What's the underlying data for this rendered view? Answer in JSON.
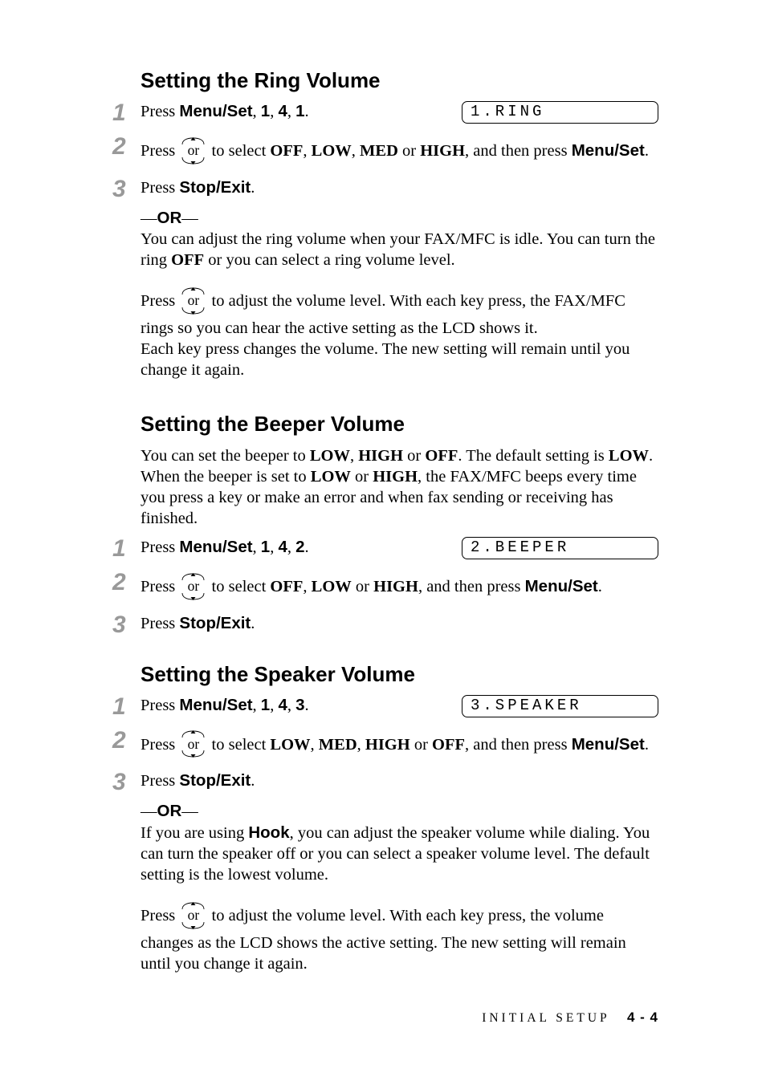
{
  "sec1": {
    "heading": "Setting the Ring Volume",
    "s1": {
      "press": "Press ",
      "key": "Menu/Set",
      "seq_a": ", ",
      "k1": "1",
      "seq_b": ", ",
      "k2": "4",
      "seq_c": ", ",
      "k3": "1",
      "end": ".",
      "lcd": "1.RING"
    },
    "s2": {
      "press": "Press ",
      "or": "or",
      "mid": " to select ",
      "o1": "OFF",
      "c1": ", ",
      "o2": "LOW",
      "c2": ", ",
      "o3": "MED",
      "c3": " or ",
      "o4": "HIGH",
      "then": ", and then press ",
      "key": "Menu/Set",
      "end": "."
    },
    "s3": {
      "press": "Press ",
      "key": "Stop/Exit",
      "end": "."
    },
    "or_pre": "—",
    "or_lbl": "OR",
    "or_suf": "—",
    "p1a": "You can adjust the ring volume when your FAX/MFC is idle. You can turn the ring ",
    "p1_off": "OFF",
    "p1b": " or you can select a ring volume level.",
    "p2a": "Press ",
    "p2_or": "or",
    "p2b": " to adjust the volume level. With each key press, the FAX/MFC rings so you can hear the active setting as the LCD shows it.",
    "p3": "Each key press changes the volume. The new setting will remain until you change it again."
  },
  "sec2": {
    "heading": "Setting the Beeper Volume",
    "p1a": "You can set the beeper to ",
    "o1": "LOW",
    "c1": ", ",
    "o2": "HIGH",
    "c2": " or ",
    "o3": "OFF",
    "p1b": ". The default setting is ",
    "o4": "LOW",
    "p1c": ". When the beeper is set to ",
    "o5": "LOW",
    "c3": " or ",
    "o6": "HIGH",
    "p1d": ", the FAX/MFC beeps every time you press a key or make an error and when fax sending or receiving has finished.",
    "s1": {
      "press": "Press ",
      "key": "Menu/Set",
      "seq_a": ", ",
      "k1": "1",
      "seq_b": ", ",
      "k2": "4",
      "seq_c": ", ",
      "k3": "2",
      "end": ".",
      "lcd": "2.BEEPER"
    },
    "s2": {
      "press": "Press ",
      "or": "or",
      "mid": " to select ",
      "o1": "OFF",
      "c1": ", ",
      "o2": "LOW",
      "c2": " or ",
      "o3": "HIGH",
      "then": ", and then press ",
      "key": "Menu/Set",
      "end": "."
    },
    "s3": {
      "press": "Press ",
      "key": "Stop/Exit",
      "end": "."
    }
  },
  "sec3": {
    "heading": "Setting the Speaker Volume",
    "s1": {
      "press": "Press ",
      "key": "Menu/Set",
      "seq_a": ", ",
      "k1": "1",
      "seq_b": ", ",
      "k2": "4",
      "seq_c": ", ",
      "k3": "3",
      "end": ".",
      "lcd": "3.SPEAKER"
    },
    "s2": {
      "press": "Press ",
      "or": "or",
      "mid": " to select ",
      "o1": "LOW",
      "c1": ", ",
      "o2": "MED",
      "c2": ", ",
      "o3": "HIGH",
      "c3": " or ",
      "o4": "OFF",
      "then": ", and then press ",
      "key": "Menu/Set",
      "end": "."
    },
    "s3": {
      "press": "Press ",
      "key": "Stop/Exit",
      "end": "."
    },
    "or_pre": "—",
    "or_lbl": "OR",
    "or_suf": "—",
    "p1a": "If you are using ",
    "hook": "Hook",
    "p1b": ", you can adjust the speaker volume while dialing. You can turn the speaker off or you can select a speaker volume level. The default setting is the lowest volume.",
    "p2a": "Press ",
    "p2_or": "or",
    "p2b": " to adjust the volume level. With each key press, the volume changes as the LCD shows the active setting. The new setting will remain until you change it again."
  },
  "footer": {
    "label": "INITIAL SETUP",
    "page": "4 - 4"
  },
  "num": {
    "n1": "1",
    "n2": "2",
    "n3": "3"
  }
}
